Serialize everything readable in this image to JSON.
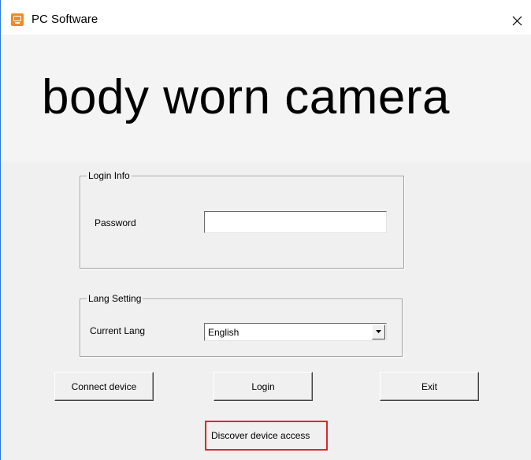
{
  "window": {
    "title": "PC Software",
    "app_icon": "monitor-icon",
    "close_icon": "close-icon"
  },
  "banner": {
    "text": "body worn camera"
  },
  "login_group": {
    "legend": "Login Info",
    "password_label": "Password",
    "password_value": ""
  },
  "lang_group": {
    "legend": "Lang Setting",
    "current_lang_label": "Current Lang",
    "current_lang_value": "English",
    "dropdown_icon": "chevron-down-icon"
  },
  "buttons": {
    "connect_label": "Connect device",
    "login_label": "Login",
    "exit_label": "Exit"
  },
  "discover": {
    "label": "Discover device access",
    "highlight_color": "#e0262a"
  },
  "colors": {
    "window_bg": "#f0f0f0",
    "app_icon_color": "#f08a24",
    "window_border": "#2b79d8"
  }
}
